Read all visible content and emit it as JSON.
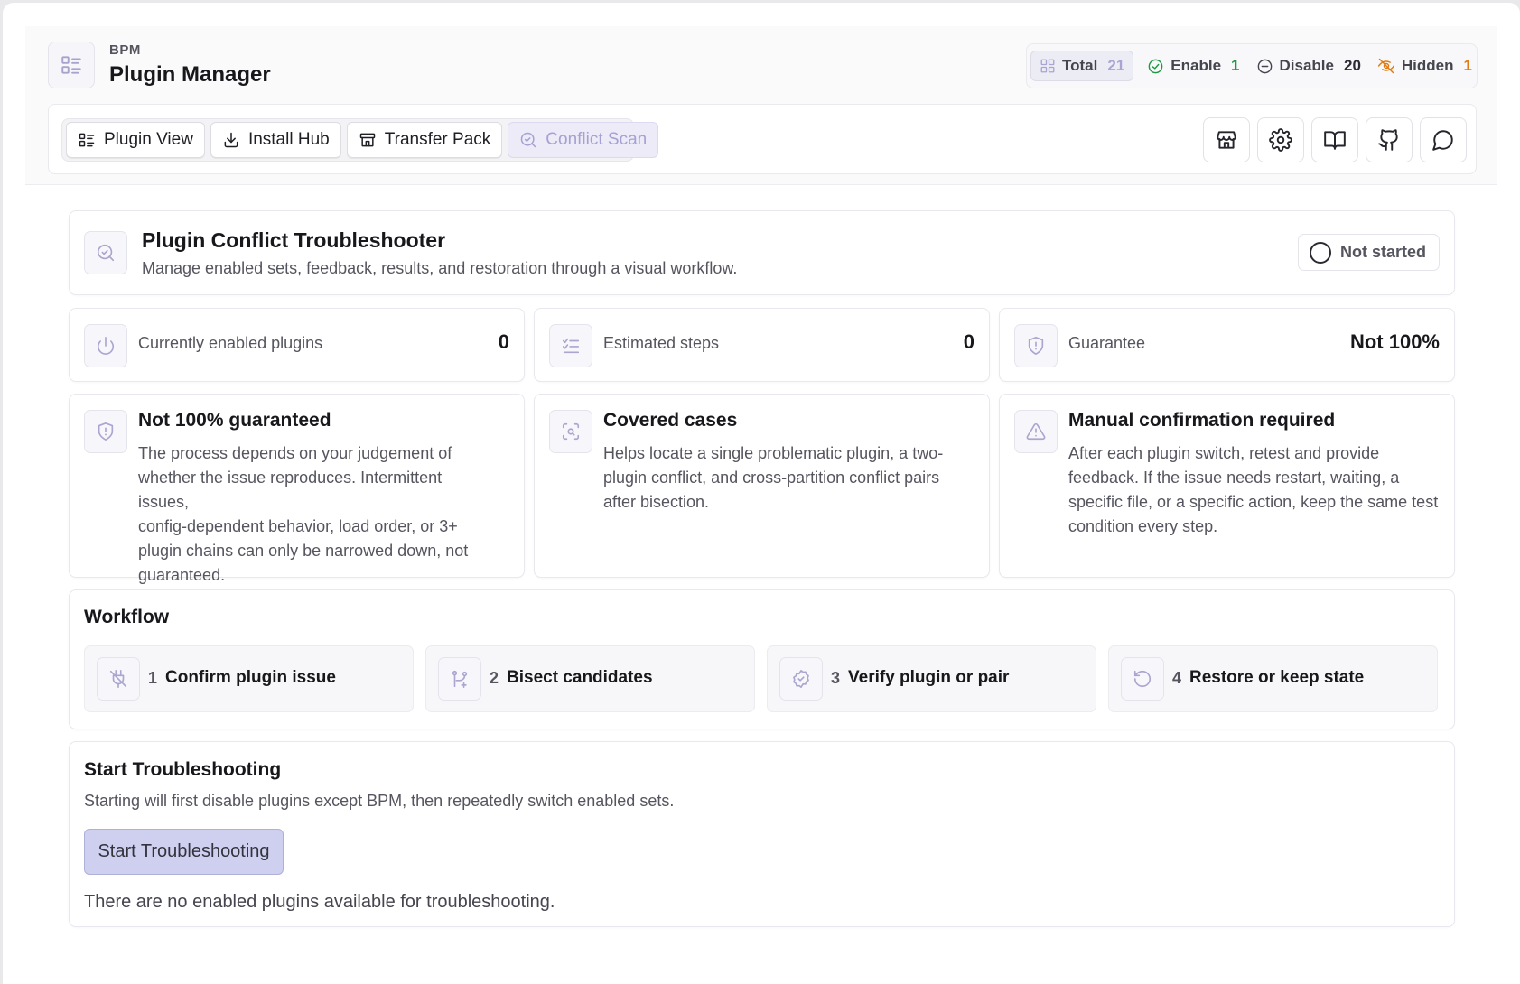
{
  "header": {
    "app_subtitle": "BPM",
    "app_title": "Plugin Manager",
    "stats": {
      "total_label": "Total",
      "total_value": "21",
      "enable_label": "Enable",
      "enable_value": "1",
      "disable_label": "Disable",
      "disable_value": "20",
      "hidden_label": "Hidden",
      "hidden_value": "1"
    }
  },
  "toolbar": {
    "tabs": [
      {
        "label": "Plugin View",
        "icon": "list-icon"
      },
      {
        "label": "Install Hub",
        "icon": "download-icon"
      },
      {
        "label": "Transfer Pack",
        "icon": "package-icon"
      },
      {
        "label": "Conflict Scan",
        "icon": "search-scan-icon",
        "active": true
      }
    ],
    "buttons": [
      "store-icon",
      "gear-icon",
      "book-icon",
      "github-icon",
      "chat-icon"
    ]
  },
  "troubleshooter": {
    "title": "Plugin Conflict Troubleshooter",
    "description": "Manage enabled sets, feedback, results, and restoration through a visual workflow.",
    "status": "Not started"
  },
  "metrics": [
    {
      "label": "Currently enabled plugins",
      "value": "0",
      "icon": "power-icon"
    },
    {
      "label": "Estimated steps",
      "value": "0",
      "icon": "checklist-icon"
    },
    {
      "label": "Guarantee",
      "value": "Not 100%",
      "icon": "shield-icon"
    }
  ],
  "info_cards": [
    {
      "title": "Not 100% guaranteed",
      "lines": [
        "The process depends on your judgement of",
        "whether the issue reproduces. Intermittent issues,",
        "config-dependent behavior, load order, or 3+",
        "plugin chains can only be narrowed down, not",
        "guaranteed."
      ],
      "icon": "shield-alert-icon"
    },
    {
      "title": "Covered cases",
      "lines": [
        "Helps locate a single problematic plugin, a two-",
        "plugin conflict, and cross-partition conflict pairs",
        "after bisection."
      ],
      "icon": "scan-search-icon"
    },
    {
      "title": "Manual confirmation required",
      "lines": [
        "After each plugin switch, retest and provide",
        "feedback. If the issue needs restart, waiting, a",
        "specific file, or a specific action, keep the same test",
        "condition every step."
      ],
      "icon": "warning-icon"
    }
  ],
  "workflow": {
    "title": "Workflow",
    "steps": [
      {
        "num": "1",
        "label": "Confirm plugin issue",
        "icon": "plug-off-icon"
      },
      {
        "num": "2",
        "label": "Bisect candidates",
        "icon": "git-branch-icon"
      },
      {
        "num": "3",
        "label": "Verify plugin or pair",
        "icon": "badge-check-icon"
      },
      {
        "num": "4",
        "label": "Restore or keep state",
        "icon": "rotate-ccw-icon"
      }
    ]
  },
  "start": {
    "title": "Start Troubleshooting",
    "description": "Starting will first disable plugins except BPM, then repeatedly switch enabled sets.",
    "button_label": "Start Troubleshooting",
    "note": "There are no enabled plugins available for troubleshooting."
  }
}
